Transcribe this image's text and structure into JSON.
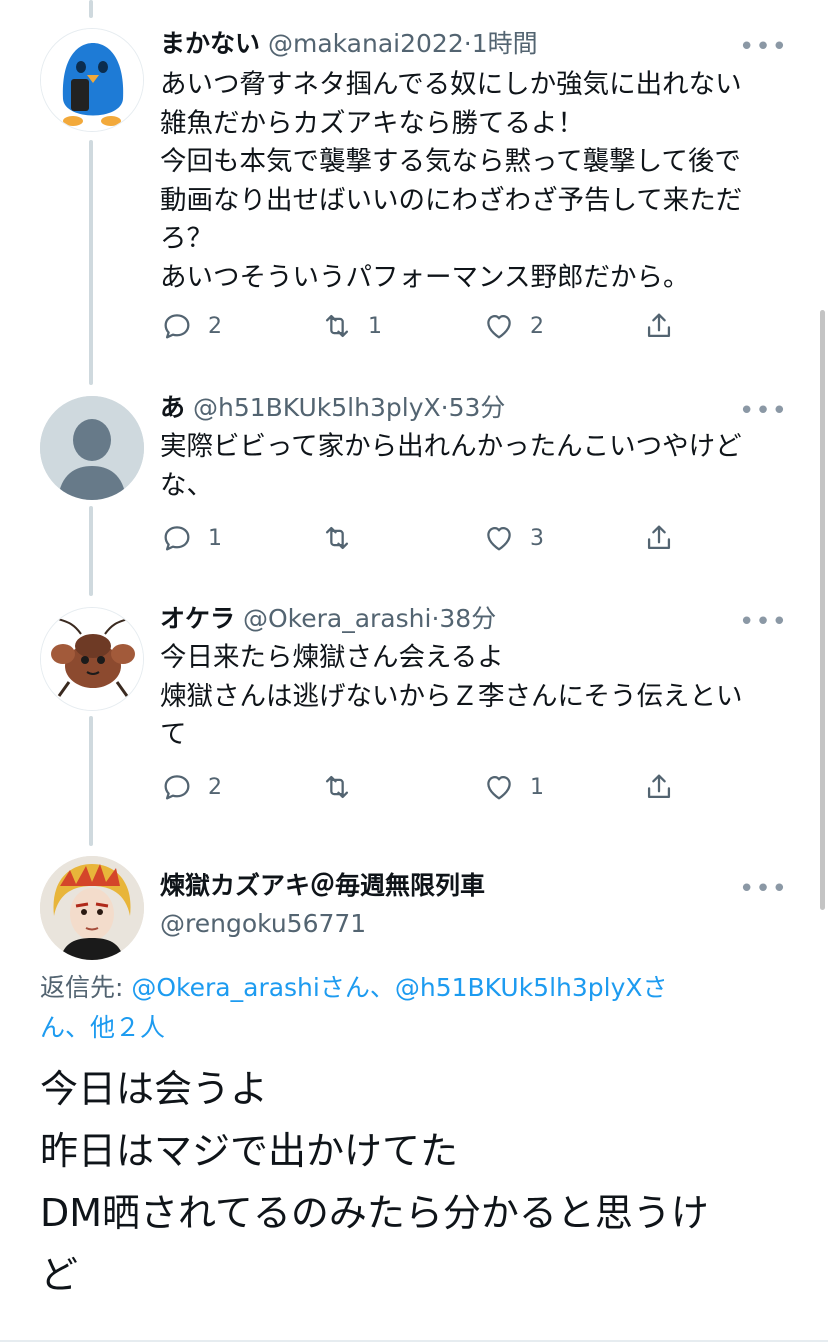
{
  "tweets": [
    {
      "display_name": "まかない",
      "handle": "@makanai2022",
      "separator": "·",
      "time": "1時間",
      "more_label": "•••",
      "body_lines": [
        "あいつ脅すネタ掴んでる奴にしか強気に出れない",
        "雑魚だからカズアキなら勝てるよ！",
        "今回も本気で襲撃する気なら黙って襲撃して後で",
        "動画なり出せばいいのにわざわざ予告して来ただ",
        "ろ？",
        "あいつそういうパフォーマンス野郎だから。"
      ],
      "counts": {
        "replies": "2",
        "retweets": "1",
        "likes": "2"
      },
      "avatar_icon": "blue-penguin-phone-avatar"
    },
    {
      "display_name": "あ",
      "handle": "@h51BKUk5lh3plyX",
      "separator": "·",
      "time": "53分",
      "more_label": "•••",
      "body_lines": [
        "実際ビビって家から出れんかったんこいつやけど",
        "な、"
      ],
      "counts": {
        "replies": "1",
        "retweets": "",
        "likes": "3"
      },
      "avatar_icon": "default-profile-avatar"
    },
    {
      "display_name": "オケラ",
      "handle": "@Okera_arashi",
      "separator": "·",
      "time": "38分",
      "more_label": "•••",
      "body_lines": [
        "今日来たら煉獄さん会えるよ",
        "煉獄さんは逃げないからＺ李さんにそう伝えとい",
        "て"
      ],
      "counts": {
        "replies": "2",
        "retweets": "",
        "likes": "1"
      },
      "avatar_icon": "mole-cricket-avatar"
    }
  ],
  "main_tweet": {
    "display_name": "煉獄カズアキ＠毎週無限列車",
    "handle": "@rengoku56771",
    "more_label": "•••",
    "avatar_icon": "cosplay-photo-avatar",
    "reply_prefix": "返信先: ",
    "reply_mention_1": "@Okera_arashi",
    "reply_mid": "さん、",
    "reply_mention_2": "@h51BKUk5lh3plyX",
    "reply_mention_2_tail": "さ",
    "reply_line2_pre": "ん、",
    "reply_others": "他２人",
    "body_lines": [
      "今日は会うよ",
      "昨日はマジで出かけてた",
      "DM晒されてるのみたら分かると思うけ",
      "ど"
    ]
  },
  "colors": {
    "accent": "#1d9bf0",
    "secondary_text": "#536471",
    "thread_line": "#cfd9de"
  }
}
